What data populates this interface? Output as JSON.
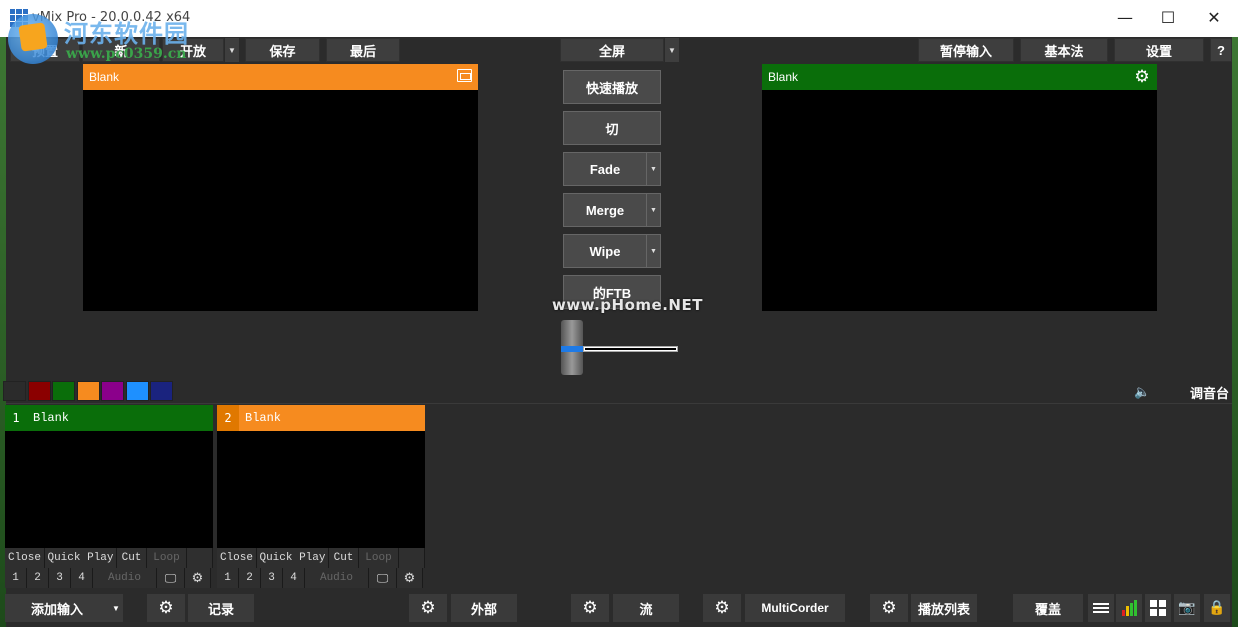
{
  "window": {
    "title": "vMix Pro - 20.0.0.42 x64",
    "minimize_glyph": "—",
    "maximize_glyph": "☐",
    "close_glyph": "✕"
  },
  "watermark": {
    "brand_text": "河东软件园",
    "url_text": "www.pc0359.cn",
    "overlay_text": "www.pHome.NET"
  },
  "toolbar": {
    "preset_label": "预置",
    "new_label": "新",
    "open_label": "开放",
    "save_label": "保存",
    "last_label": "最后",
    "fullscreen_label": "全屏",
    "pause_input_label": "暂停输入",
    "basic_label": "基本法",
    "settings_label": "设置",
    "help_label": "?"
  },
  "preview": {
    "title": "Blank",
    "header_color": "#f68b1f"
  },
  "output": {
    "title": "Blank",
    "header_color": "#0a6e0a"
  },
  "transitions": {
    "quick_play_label": "快速播放",
    "cut_label": "切",
    "fade_label": "Fade",
    "merge_label": "Merge",
    "wipe_label": "Wipe",
    "ftb_label": "的FTB",
    "tbar_position": 0
  },
  "color_tags": [
    "#2b2b2b",
    "#8b0000",
    "#0a6e0a",
    "#f68b1f",
    "#8b008b",
    "#1e90ff",
    "#1a237e"
  ],
  "mixer_label": "调音台",
  "inputs": [
    {
      "number": "1",
      "title": "Blank",
      "header_color": "#0a6e0a",
      "close_label": "Close",
      "quickplay_label": "Quick Play",
      "cut_label": "Cut",
      "loop_label": "Loop",
      "n1": "1",
      "n2": "2",
      "n3": "3",
      "n4": "4",
      "audio_label": "Audio"
    },
    {
      "number": "2",
      "title": "Blank",
      "header_color": "#f68b1f",
      "close_label": "Close",
      "quickplay_label": "Quick Play",
      "cut_label": "Cut",
      "loop_label": "Loop",
      "n1": "1",
      "n2": "2",
      "n3": "3",
      "n4": "4",
      "audio_label": "Audio"
    }
  ],
  "bottombar": {
    "add_input_label": "添加输入",
    "record_label": "记录",
    "external_label": "外部",
    "stream_label": "流",
    "multicorder_label": "MultiCorder",
    "playlist_label": "播放列表",
    "overlay_label": "覆盖"
  },
  "icons": {
    "gear": "⚙",
    "speaker": "🔈",
    "dropdown": "▼",
    "monitor": "🖵",
    "lock": "🔒",
    "camera": "📷"
  }
}
